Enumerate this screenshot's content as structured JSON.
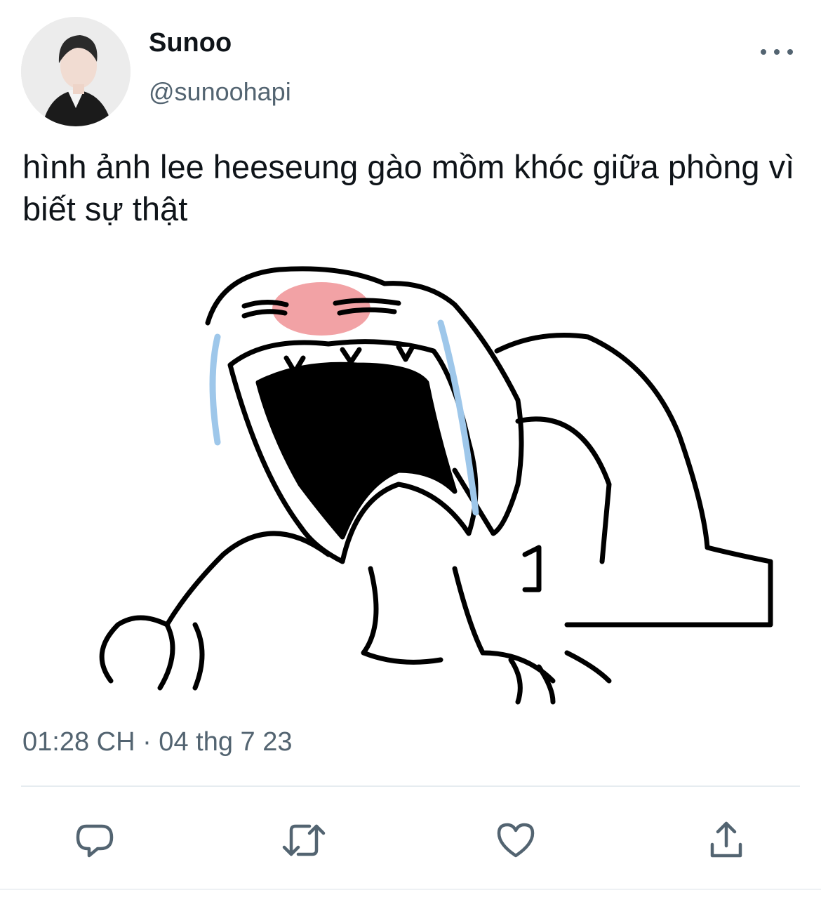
{
  "tweet": {
    "display_name": "Sunoo",
    "handle": "@sunoohapi",
    "text": "hình ảnh lee heeseung gào mồm khóc giữa phòng vì biết sự thật",
    "timestamp": "01:28 CH · 04 thg 7 23"
  },
  "icons": {
    "more": "more-horizontal-icon",
    "reply": "reply-icon",
    "retweet": "retweet-icon",
    "like": "heart-icon",
    "share": "share-icon"
  },
  "colors": {
    "text_primary": "#0f1419",
    "text_secondary": "#536471",
    "tear": "#9ec7ea",
    "blush": "#f2a2a5"
  }
}
